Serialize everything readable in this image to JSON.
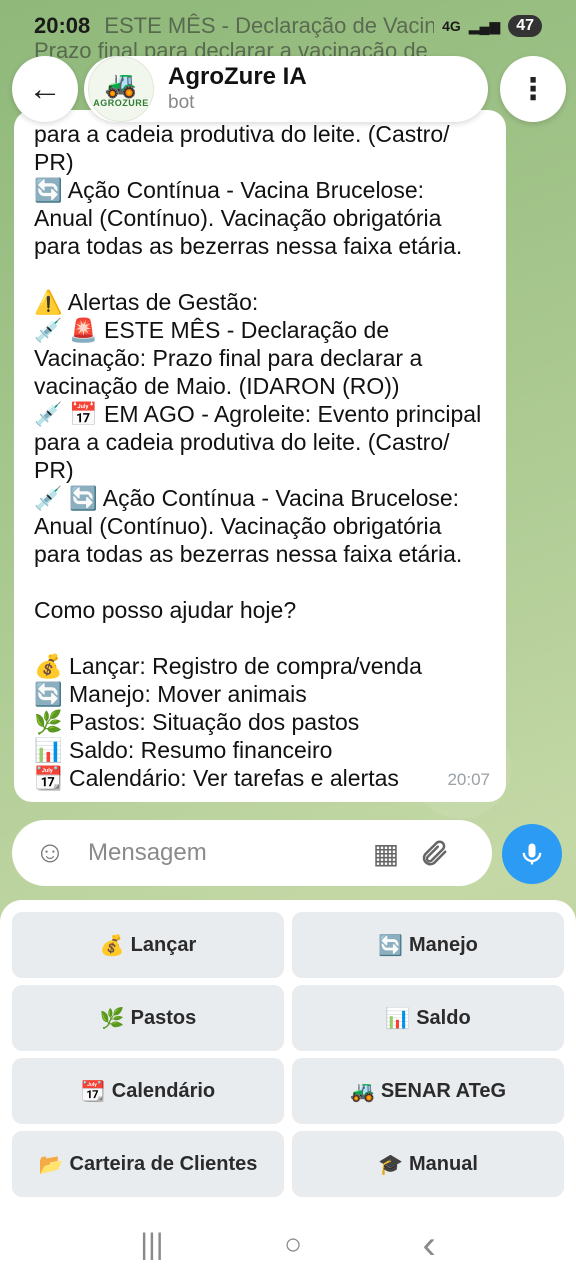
{
  "status_bar": {
    "time": "20:08",
    "notification_text": "ESTE MÊS - Declaração de Vacinação",
    "notification_text2": "Prazo final para declarar a vacinação de",
    "network": "4G",
    "battery": "47"
  },
  "header": {
    "title": "AgroZure IA",
    "subtitle": "bot",
    "avatar_brand": "AGROZURE"
  },
  "message": {
    "lines": [
      "para a cadeia produtiva do leite. (Castro/",
      "PR)",
      "🔄 Ação Contínua - Vacina Brucelose:",
      "Anual (Contínuo). Vacinação obrigatória",
      "para todas as bezerras nessa faixa etária.",
      "",
      "⚠️ Alertas de Gestão:",
      "💉 🚨 ESTE MÊS - Declaração de",
      "Vacinação: Prazo final para declarar a",
      "vacinação de Maio. (IDARON (RO))",
      "💉 📅 EM AGO - Agroleite: Evento principal",
      "para a cadeia produtiva do leite. (Castro/",
      "PR)",
      "💉 🔄 Ação Contínua - Vacina Brucelose:",
      "Anual (Contínuo). Vacinação obrigatória",
      "para todas as bezerras nessa faixa etária.",
      "",
      "Como posso ajudar hoje?",
      "",
      "💰 Lançar: Registro de compra/venda",
      "🔄 Manejo: Mover animais",
      "🌿 Pastos: Situação dos pastos",
      "📊 Saldo: Resumo financeiro",
      "📆 Calendário: Ver tarefas e alertas"
    ],
    "time": "20:07"
  },
  "composer": {
    "placeholder": "Mensagem"
  },
  "keyboard": {
    "buttons": [
      {
        "icon": "💰",
        "label": "Lançar"
      },
      {
        "icon": "🔄",
        "label": "Manejo"
      },
      {
        "icon": "🌿",
        "label": "Pastos"
      },
      {
        "icon": "📊",
        "label": "Saldo"
      },
      {
        "icon": "📆",
        "label": "Calendário"
      },
      {
        "icon": "🚜",
        "label": "SENAR ATeG"
      },
      {
        "icon": "📂",
        "label": "Carteira de Clientes"
      },
      {
        "icon": "🎓",
        "label": "Manual"
      }
    ]
  },
  "icons": {
    "back": "←",
    "menu": "⋮",
    "emoji": "☺",
    "stickers": "▦",
    "attach": "📎",
    "mic": "mic-icon",
    "nav_recents": "|||",
    "nav_home": "○",
    "nav_back": "‹"
  },
  "colors": {
    "accent": "#2b9bf4",
    "bubble": "#ffffff",
    "key_bg": "#e9ecef"
  }
}
